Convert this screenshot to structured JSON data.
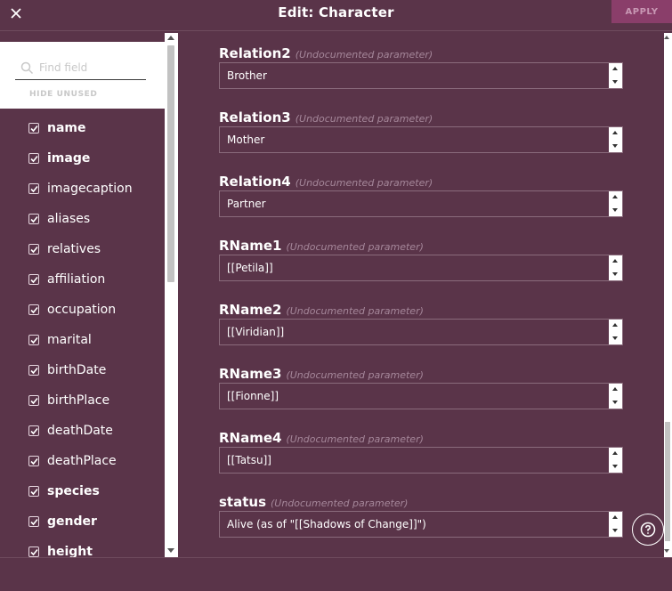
{
  "header": {
    "title": "Edit: Character",
    "apply_label": "APPLY"
  },
  "search": {
    "placeholder": "Find field"
  },
  "hide_unused_label": "HIDE UNUSED",
  "fields": [
    {
      "label": "name",
      "bold": true
    },
    {
      "label": "image",
      "bold": true
    },
    {
      "label": "imagecaption",
      "bold": false
    },
    {
      "label": "aliases",
      "bold": false
    },
    {
      "label": "relatives",
      "bold": false
    },
    {
      "label": "affiliation",
      "bold": false
    },
    {
      "label": "occupation",
      "bold": false
    },
    {
      "label": "marital",
      "bold": false
    },
    {
      "label": "birthDate",
      "bold": false
    },
    {
      "label": "birthPlace",
      "bold": false
    },
    {
      "label": "deathDate",
      "bold": false
    },
    {
      "label": "deathPlace",
      "bold": false
    },
    {
      "label": "species",
      "bold": true
    },
    {
      "label": "gender",
      "bold": true
    },
    {
      "label": "height",
      "bold": true
    }
  ],
  "params": [
    {
      "name": "Relation2",
      "note": "(Undocumented parameter)",
      "value": "Brother"
    },
    {
      "name": "Relation3",
      "note": "(Undocumented parameter)",
      "value": "Mother"
    },
    {
      "name": "Relation4",
      "note": "(Undocumented parameter)",
      "value": "Partner"
    },
    {
      "name": "RName1",
      "note": "(Undocumented parameter)",
      "value": "[[Petila]]"
    },
    {
      "name": "RName2",
      "note": "(Undocumented parameter)",
      "value": "[[Viridian]]"
    },
    {
      "name": "RName3",
      "note": "(Undocumented parameter)",
      "value": "[[Fionne]]"
    },
    {
      "name": "RName4",
      "note": "(Undocumented parameter)",
      "value": "[[Tatsu]]"
    },
    {
      "name": "status",
      "note": "(Undocumented parameter)",
      "value": "Alive (as of \"[[Shadows of Change]]\")"
    }
  ],
  "colors": {
    "background": "#5a3449",
    "apply": "#8a3e6a"
  },
  "icons": {
    "close": "close-icon",
    "search": "search-icon",
    "check": "check-icon",
    "help": "question-circle-icon"
  }
}
